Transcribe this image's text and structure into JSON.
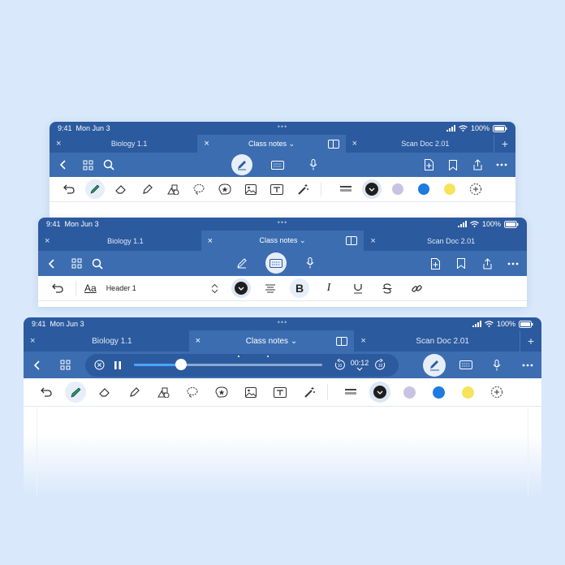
{
  "status": {
    "time": "9:41",
    "date": "Mon Jun 3",
    "battery": "100%"
  },
  "tabs": [
    {
      "label": "Biology 1.1"
    },
    {
      "label": "Class notes"
    },
    {
      "label": "Scan Doc 2.01"
    }
  ],
  "format": {
    "style_sample": "Aa",
    "style_name": "Header 1"
  },
  "audio": {
    "time": "00:12",
    "progress": 0.25,
    "skip_back": "10",
    "skip_forward": "10"
  },
  "colors": {
    "selected": "#1e1e1e",
    "lavender": "#c9c3e3",
    "blue": "#1f7ae0",
    "yellow": "#f5e45a",
    "accent": "#2c5a9e"
  }
}
